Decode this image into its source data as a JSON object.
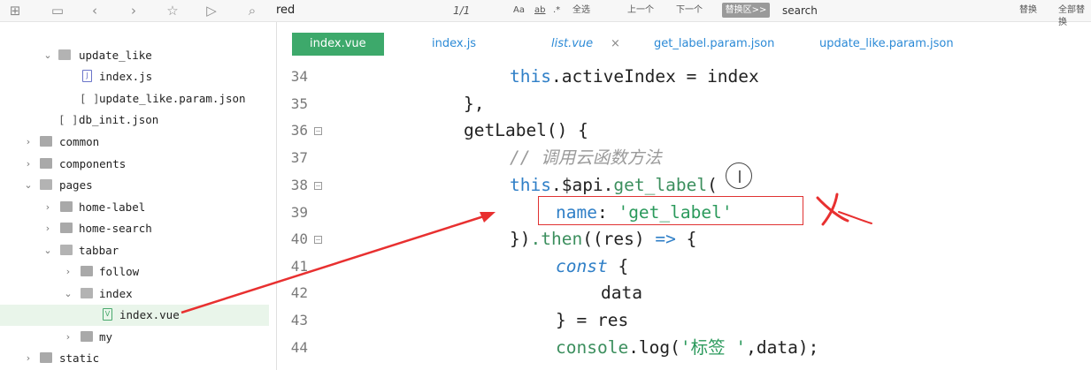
{
  "toolbar": {
    "search_text": "red",
    "match_count": "1/1",
    "opt_case": "Aa",
    "opt_word": "ab",
    "opt_regex": ".*",
    "select_all": "全选",
    "prev": "上一个",
    "next": "下一个",
    "swap_area": "替换区>>",
    "replace_text": "search",
    "replace": "替换",
    "replace_all": "全部替换"
  },
  "sidebar": {
    "items": [
      {
        "label": "update_like",
        "kind": "folder-open",
        "depth": 2
      },
      {
        "label": "index.js",
        "kind": "js",
        "depth": 3
      },
      {
        "label": "update_like.param.json",
        "kind": "json",
        "depth": 3
      },
      {
        "label": "db_init.json",
        "kind": "json",
        "depth": 2
      },
      {
        "label": "common",
        "kind": "folder",
        "depth": 1
      },
      {
        "label": "components",
        "kind": "folder",
        "depth": 1
      },
      {
        "label": "pages",
        "kind": "folder-open",
        "depth": 1
      },
      {
        "label": "home-label",
        "kind": "folder",
        "depth": 2
      },
      {
        "label": "home-search",
        "kind": "folder",
        "depth": 2
      },
      {
        "label": "tabbar",
        "kind": "folder-open",
        "depth": 2
      },
      {
        "label": "follow",
        "kind": "folder",
        "depth": 3
      },
      {
        "label": "index",
        "kind": "folder-open",
        "depth": 3
      },
      {
        "label": "index.vue",
        "kind": "vue",
        "depth": 4
      },
      {
        "label": "my",
        "kind": "folder",
        "depth": 3
      },
      {
        "label": "static",
        "kind": "folder",
        "depth": 1
      }
    ]
  },
  "tabs": [
    {
      "label": "index.vue",
      "active": true
    },
    {
      "label": "index.js",
      "active": false
    },
    {
      "label": "list.vue",
      "active": false,
      "italic": true
    },
    {
      "label": "get_label.param.json",
      "active": false
    },
    {
      "label": "update_like.param.json",
      "active": false
    }
  ],
  "tab_close": "×",
  "editor": {
    "lines": [
      {
        "num": "34",
        "code": "this.activeIndex = index"
      },
      {
        "num": "35",
        "code": "},"
      },
      {
        "num": "36",
        "code": "getLabel() {"
      },
      {
        "num": "37",
        "code": "// 调用云函数方法"
      },
      {
        "num": "38",
        "code": "this.$api.get_label({"
      },
      {
        "num": "39",
        "code": "name: 'get_label'"
      },
      {
        "num": "40",
        "code": "}).then((res) => {"
      },
      {
        "num": "41",
        "code": "const {"
      },
      {
        "num": "42",
        "code": "data"
      },
      {
        "num": "43",
        "code": "} = res"
      },
      {
        "num": "44",
        "code": "console.log('标签 ',data);"
      }
    ],
    "tokens": {
      "t34a": "this",
      "t34b": ".activeIndex = index",
      "t35": "},",
      "t36": "getLabel() {",
      "t37": "// 调用云函数方法",
      "t38a": "this",
      "t38b": ".$api.",
      "t38c": "get_label",
      "t38d": "(",
      "t39a": "name",
      "t39b": ": ",
      "t39c": "'get_label'",
      "t40a": "})",
      "t40b": ".then",
      "t40c": "((res) ",
      "t40d": "=>",
      "t40e": " {",
      "t41a": "const",
      "t41b": " {",
      "t42": "data",
      "t43": "} = res",
      "t44a": "console",
      "t44b": ".log(",
      "t44c": "'标签 '",
      "t44d": ",data);"
    }
  },
  "annotation_colors": {
    "arrow": "#e83030",
    "box": "#e03232",
    "selection": "#bcd79a"
  }
}
